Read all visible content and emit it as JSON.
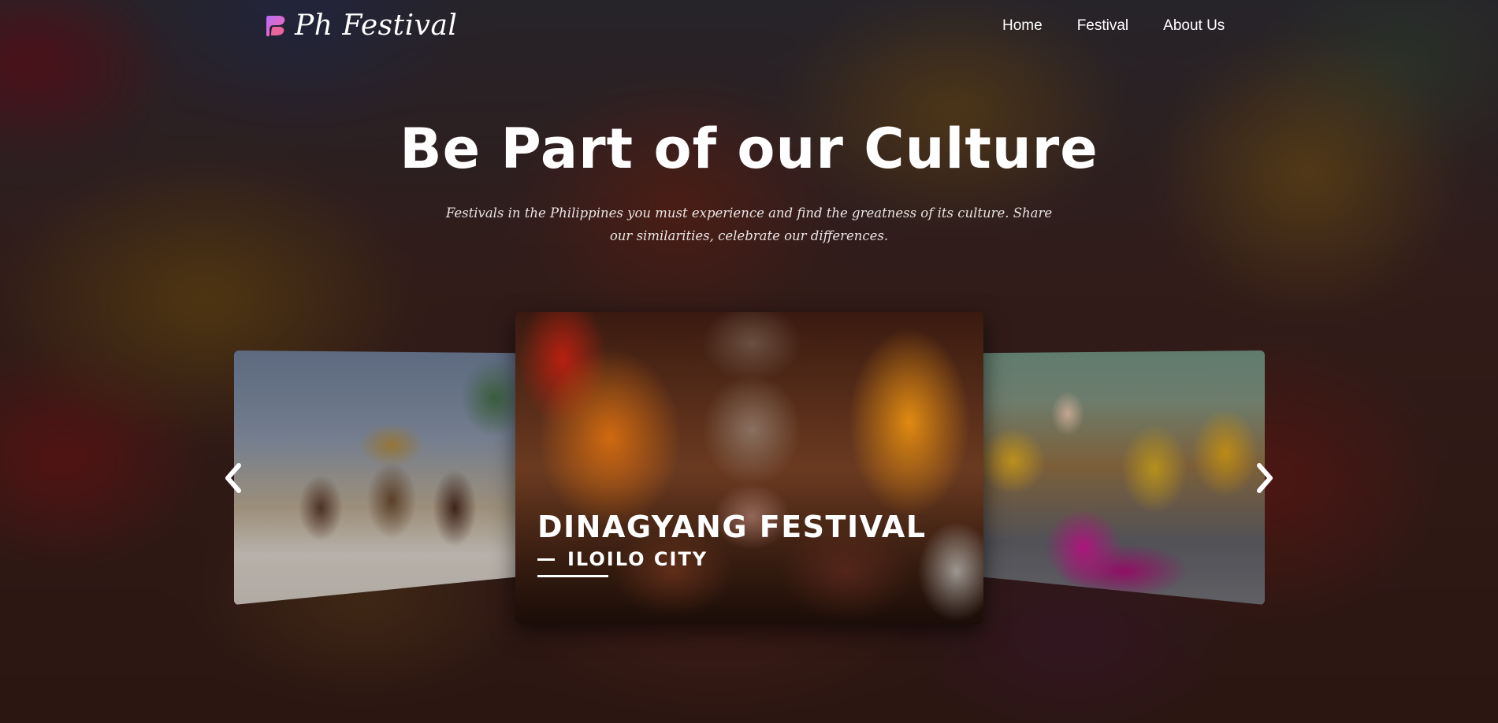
{
  "nav": {
    "brand": "Ph Festival",
    "links": [
      "Home",
      "Festival",
      "About Us"
    ]
  },
  "hero": {
    "title": "Be Part of our Culture",
    "subtitle": "Festivals in the Philippines you must experience and find the greatness of its culture. Share our similarities, celebrate our differences."
  },
  "carousel": {
    "active_slide": {
      "title": "DINAGYANG FESTIVAL",
      "location": "ILOILO CITY"
    },
    "prev_icon": "chevron-left-icon",
    "next_icon": "chevron-right-icon"
  },
  "colors": {
    "logo_gradient_start": "#b46cf4",
    "logo_gradient_end": "#ff6aa8",
    "text": "#ffffff"
  }
}
